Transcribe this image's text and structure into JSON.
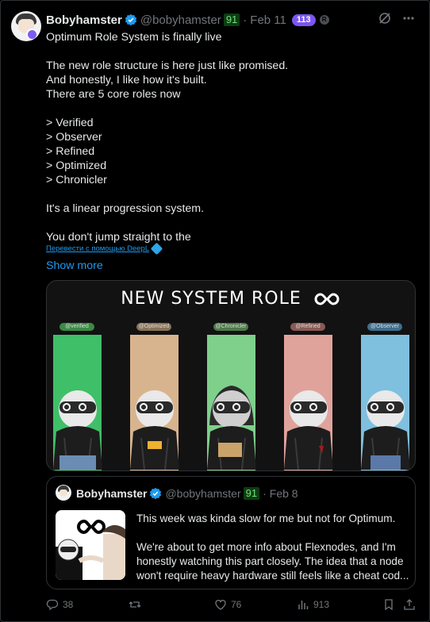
{
  "post": {
    "author_name": "Bobyhamster",
    "handle": "@bobyhamster",
    "score_badge": "91",
    "date": "Feb 11",
    "pill_count": "113",
    "r_badge": "R",
    "lines": [
      "Optimum Role System is finally live",
      "",
      "The new role structure is here  just like promised.",
      "And honestly, I like how it's built.",
      "There are 5 core roles now",
      "",
      "> Verified",
      "> Observer",
      "> Refined",
      "> Optimized",
      "> Chronicler",
      "",
      "It's a linear progression system.",
      "",
      "You don't jump straight to the"
    ],
    "translate_link": "Перевести с помощью DeepL",
    "show_more": "Show more"
  },
  "media": {
    "title": "NEW SYSTEM ROLE",
    "roles": [
      {
        "tag": "@verified",
        "tag_color": "#3c8a45",
        "col_color": "#3fbf68"
      },
      {
        "tag": "@Optimized",
        "tag_color": "#8a7358",
        "col_color": "#d8b48e"
      },
      {
        "tag": "@Chronicler",
        "tag_color": "#4d7a4a",
        "col_color": "#7ed08b"
      },
      {
        "tag": "@Refined",
        "tag_color": "#8a5a55",
        "col_color": "#e0a39c"
      },
      {
        "tag": "@Observer",
        "tag_color": "#3f6f8e",
        "col_color": "#7fc0df"
      }
    ]
  },
  "quote": {
    "author_name": "Bobyhamster",
    "handle": "@bobyhamster",
    "score_badge": "91",
    "date": "Feb 8",
    "lines": [
      "This week was kinda slow for me but not for Optimum.",
      "",
      "We're about to get more info about Flexnodes, and I'm",
      "honestly watching this part closely. The idea that a node",
      "won't require heavy hardware still feels like a cheat cod..."
    ]
  },
  "actions": {
    "replies": "38",
    "reposts": "",
    "likes": "76",
    "views": "913"
  },
  "colors": {
    "accent": "#1d9bf0",
    "pill": "#7a56f0",
    "badge_green": "#6fe27b"
  }
}
